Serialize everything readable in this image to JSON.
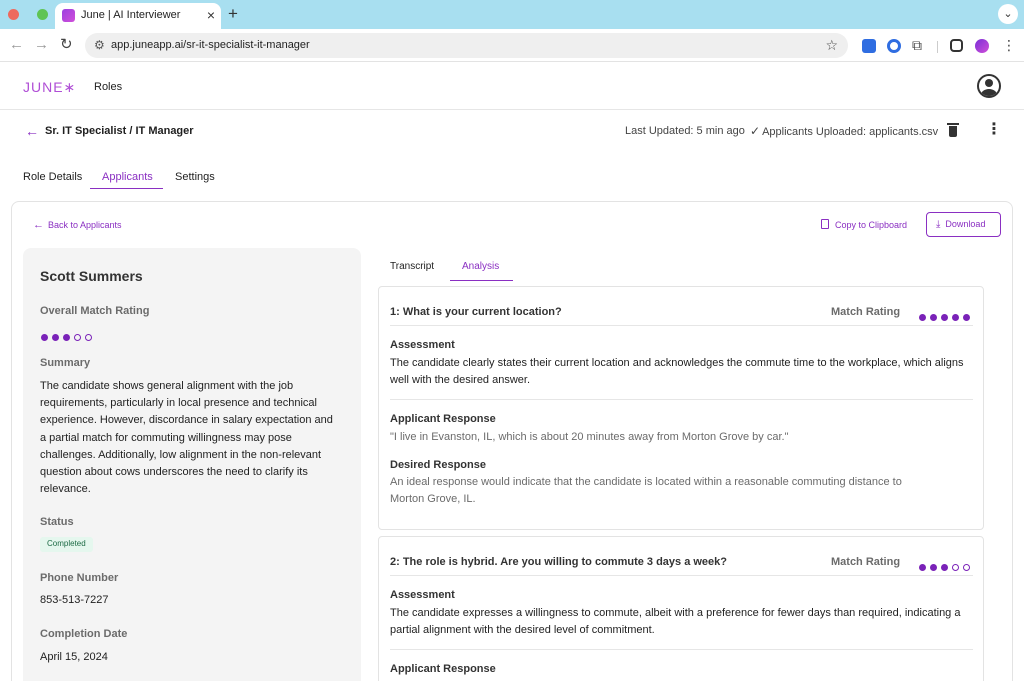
{
  "browser": {
    "tab_title": "June | AI Interviewer",
    "close_glyph": "×",
    "new_tab_glyph": "+",
    "url": "app.juneapp.ai/sr-it-specialist-it-manager"
  },
  "app": {
    "logo": "JUNE∗",
    "nav_roles": "Roles"
  },
  "role": {
    "title": "Sr. IT Specialist / IT Manager",
    "last_updated": "Last Updated: 5 min ago",
    "uploaded": "Applicants Uploaded: applicants.csv"
  },
  "tabs": {
    "role_details": "Role Details",
    "applicants": "Applicants",
    "settings": "Settings"
  },
  "actions": {
    "back": "Back to Applicants",
    "copy": "Copy to Clipboard",
    "download": "Download"
  },
  "candidate": {
    "name": "Scott Summers",
    "overall_label": "Overall Match Rating",
    "overall_rating": 3,
    "overall_max": 5,
    "summary_label": "Summary",
    "summary": "The candidate shows general alignment with the job requirements, particularly in local presence and technical experience. However, discordance in salary expectation and a partial match for commuting willingness may pose challenges. Additionally, low alignment in the non-relevant question about cows underscores the need to clarify its relevance.",
    "status_label": "Status",
    "status": "Completed",
    "phone_label": "Phone Number",
    "phone": "853-513-7227",
    "date_label": "Completion Date",
    "date": "April 15, 2024"
  },
  "detail_tabs": {
    "transcript": "Transcript",
    "analysis": "Analysis"
  },
  "questions": [
    {
      "title": "1: What is your current location?",
      "match_label": "Match Rating",
      "rating": 5,
      "max": 5,
      "assessment_label": "Assessment",
      "assessment": "The candidate clearly states their current location and acknowledges the commute time to the workplace, which aligns well with the desired answer.",
      "applicant_label": "Applicant Response",
      "applicant": "\"I live in Evanston, IL, which is about 20 minutes away from Morton Grove by car.\"",
      "desired_label": "Desired Response",
      "desired": "An ideal response would indicate that the candidate is located within a reasonable commuting distance to Morton Grove, IL."
    },
    {
      "title": "2: The role is hybrid. Are you willing to commute 3 days a week?",
      "match_label": "Match Rating",
      "rating": 3,
      "max": 5,
      "assessment_label": "Assessment",
      "assessment": "The candidate expresses a willingness to commute, albeit with a preference for fewer days than required, indicating a partial alignment with the desired level of commitment.",
      "applicant_label": "Applicant Response"
    }
  ]
}
